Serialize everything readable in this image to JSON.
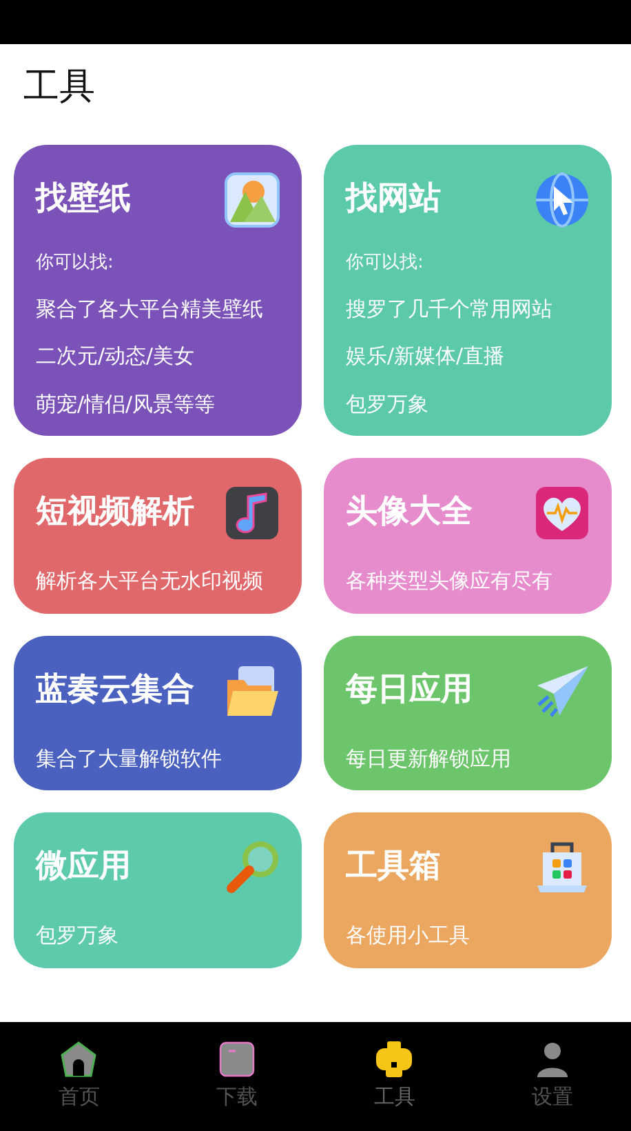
{
  "page_title": "工具",
  "cards": [
    {
      "title": "找壁纸",
      "color": "#7b52b8",
      "intro": "你可以找:",
      "lines": [
        "聚合了各大平台精美壁纸",
        "二次元/动态/美女",
        "萌宠/情侣/风景等等"
      ]
    },
    {
      "title": "找网站",
      "color": "#5cc9a9",
      "intro": "你可以找:",
      "lines": [
        "搜罗了几千个常用网站",
        "娱乐/新媒体/直播",
        "包罗万象"
      ]
    },
    {
      "title": "短视频解析",
      "color": "#e0676a",
      "lines": [
        "解析各大平台无水印视频"
      ]
    },
    {
      "title": "头像大全",
      "color": "#e68ccd",
      "lines": [
        "各种类型头像应有尽有"
      ]
    },
    {
      "title": "蓝奏云集合",
      "color": "#4a61bf",
      "lines": [
        "集合了大量解锁软件"
      ]
    },
    {
      "title": "每日应用",
      "color": "#6cc56a",
      "lines": [
        "每日更新解锁应用"
      ]
    },
    {
      "title": "微应用",
      "color": "#5ccaab",
      "lines": [
        "包罗万象"
      ]
    },
    {
      "title": "工具箱",
      "color": "#eba75f",
      "lines": [
        "各使用小工具"
      ]
    }
  ],
  "tab_bar": [
    {
      "label": "首页",
      "selected": false
    },
    {
      "label": "下载",
      "selected": false
    },
    {
      "label": "工具",
      "selected": true
    },
    {
      "label": "设置",
      "selected": false
    }
  ]
}
